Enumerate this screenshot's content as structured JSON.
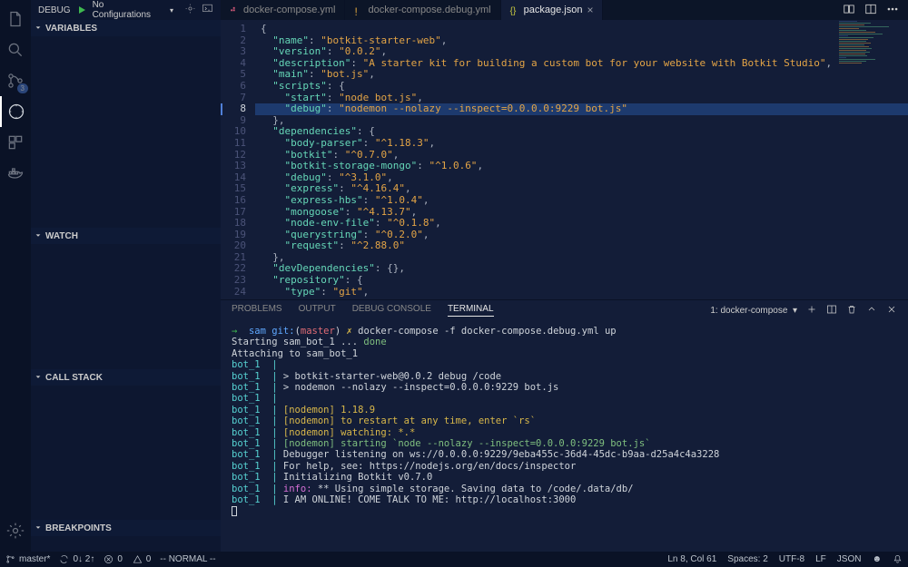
{
  "sidebar": {
    "debug_label": "DEBUG",
    "no_configurations": "No Configurations",
    "sections": [
      {
        "label": "VARIABLES"
      },
      {
        "label": "WATCH"
      },
      {
        "label": "CALL STACK"
      },
      {
        "label": "BREAKPOINTS"
      }
    ],
    "scm_badge": "3"
  },
  "tabs": [
    {
      "label": "docker-compose.yml",
      "icon": "docker",
      "dirty": false,
      "active": false
    },
    {
      "label": "docker-compose.debug.yml",
      "icon": "warn",
      "dirty": false,
      "active": false
    },
    {
      "label": "package.json",
      "icon": "json",
      "dirty": false,
      "active": true
    }
  ],
  "editor": {
    "lines": [
      {
        "n": 1,
        "tokens": [
          [
            "p",
            "{"
          ]
        ]
      },
      {
        "n": 2,
        "tokens": [
          [
            "p",
            "  "
          ],
          [
            "k",
            "\"name\""
          ],
          [
            "p",
            ": "
          ],
          [
            "s",
            "\"botkit-starter-web\""
          ],
          [
            "p",
            ","
          ]
        ]
      },
      {
        "n": 3,
        "tokens": [
          [
            "p",
            "  "
          ],
          [
            "k",
            "\"version\""
          ],
          [
            "p",
            ": "
          ],
          [
            "s",
            "\"0.0.2\""
          ],
          [
            "p",
            ","
          ]
        ]
      },
      {
        "n": 4,
        "tokens": [
          [
            "p",
            "  "
          ],
          [
            "k",
            "\"description\""
          ],
          [
            "p",
            ": "
          ],
          [
            "s",
            "\"A starter kit for building a custom bot for your website with Botkit Studio\""
          ],
          [
            "p",
            ","
          ]
        ]
      },
      {
        "n": 5,
        "tokens": [
          [
            "p",
            "  "
          ],
          [
            "k",
            "\"main\""
          ],
          [
            "p",
            ": "
          ],
          [
            "s",
            "\"bot.js\""
          ],
          [
            "p",
            ","
          ]
        ]
      },
      {
        "n": 6,
        "tokens": [
          [
            "p",
            "  "
          ],
          [
            "k",
            "\"scripts\""
          ],
          [
            "p",
            ": {"
          ]
        ]
      },
      {
        "n": 7,
        "tokens": [
          [
            "p",
            "    "
          ],
          [
            "k",
            "\"start\""
          ],
          [
            "p",
            ": "
          ],
          [
            "s",
            "\"node bot.js\""
          ],
          [
            "p",
            ","
          ]
        ]
      },
      {
        "n": 8,
        "hl": true,
        "tokens": [
          [
            "p",
            "    "
          ],
          [
            "k",
            "\"debug\""
          ],
          [
            "p",
            ": "
          ],
          [
            "s",
            "\"nodemon --nolazy --inspect=0.0.0.0:9229 bot.js\""
          ]
        ]
      },
      {
        "n": 9,
        "tokens": [
          [
            "p",
            "  },"
          ]
        ]
      },
      {
        "n": 10,
        "tokens": [
          [
            "p",
            "  "
          ],
          [
            "k",
            "\"dependencies\""
          ],
          [
            "p",
            ": {"
          ]
        ]
      },
      {
        "n": 11,
        "tokens": [
          [
            "p",
            "    "
          ],
          [
            "k",
            "\"body-parser\""
          ],
          [
            "p",
            ": "
          ],
          [
            "s",
            "\"^1.18.3\""
          ],
          [
            "p",
            ","
          ]
        ]
      },
      {
        "n": 12,
        "tokens": [
          [
            "p",
            "    "
          ],
          [
            "k",
            "\"botkit\""
          ],
          [
            "p",
            ": "
          ],
          [
            "s",
            "\"^0.7.0\""
          ],
          [
            "p",
            ","
          ]
        ]
      },
      {
        "n": 13,
        "tokens": [
          [
            "p",
            "    "
          ],
          [
            "k",
            "\"botkit-storage-mongo\""
          ],
          [
            "p",
            ": "
          ],
          [
            "s",
            "\"^1.0.6\""
          ],
          [
            "p",
            ","
          ]
        ]
      },
      {
        "n": 14,
        "tokens": [
          [
            "p",
            "    "
          ],
          [
            "k",
            "\"debug\""
          ],
          [
            "p",
            ": "
          ],
          [
            "s",
            "\"^3.1.0\""
          ],
          [
            "p",
            ","
          ]
        ]
      },
      {
        "n": 15,
        "tokens": [
          [
            "p",
            "    "
          ],
          [
            "k",
            "\"express\""
          ],
          [
            "p",
            ": "
          ],
          [
            "s",
            "\"^4.16.4\""
          ],
          [
            "p",
            ","
          ]
        ]
      },
      {
        "n": 16,
        "tokens": [
          [
            "p",
            "    "
          ],
          [
            "k",
            "\"express-hbs\""
          ],
          [
            "p",
            ": "
          ],
          [
            "s",
            "\"^1.0.4\""
          ],
          [
            "p",
            ","
          ]
        ]
      },
      {
        "n": 17,
        "tokens": [
          [
            "p",
            "    "
          ],
          [
            "k",
            "\"mongoose\""
          ],
          [
            "p",
            ": "
          ],
          [
            "s",
            "\"^4.13.7\""
          ],
          [
            "p",
            ","
          ]
        ]
      },
      {
        "n": 18,
        "tokens": [
          [
            "p",
            "    "
          ],
          [
            "k",
            "\"node-env-file\""
          ],
          [
            "p",
            ": "
          ],
          [
            "s",
            "\"^0.1.8\""
          ],
          [
            "p",
            ","
          ]
        ]
      },
      {
        "n": 19,
        "tokens": [
          [
            "p",
            "    "
          ],
          [
            "k",
            "\"querystring\""
          ],
          [
            "p",
            ": "
          ],
          [
            "s",
            "\"^0.2.0\""
          ],
          [
            "p",
            ","
          ]
        ]
      },
      {
        "n": 20,
        "tokens": [
          [
            "p",
            "    "
          ],
          [
            "k",
            "\"request\""
          ],
          [
            "p",
            ": "
          ],
          [
            "s",
            "\"^2.88.0\""
          ]
        ]
      },
      {
        "n": 21,
        "tokens": [
          [
            "p",
            "  },"
          ]
        ]
      },
      {
        "n": 22,
        "tokens": [
          [
            "p",
            "  "
          ],
          [
            "k",
            "\"devDependencies\""
          ],
          [
            "p",
            ": {},"
          ]
        ]
      },
      {
        "n": 23,
        "tokens": [
          [
            "p",
            "  "
          ],
          [
            "k",
            "\"repository\""
          ],
          [
            "p",
            ": {"
          ]
        ]
      },
      {
        "n": 24,
        "tokens": [
          [
            "p",
            "    "
          ],
          [
            "k",
            "\"type\""
          ],
          [
            "p",
            ": "
          ],
          [
            "s",
            "\"git\""
          ],
          [
            "p",
            ","
          ]
        ]
      }
    ]
  },
  "panel": {
    "tabs": [
      {
        "label": "PROBLEMS",
        "active": false
      },
      {
        "label": "OUTPUT",
        "active": false
      },
      {
        "label": "DEBUG CONSOLE",
        "active": false
      },
      {
        "label": "TERMINAL",
        "active": true
      }
    ],
    "terminal_selector": "1: docker-compose",
    "terminal_lines": [
      [
        [
          "arrow",
          "→  "
        ],
        [
          "blue",
          "sam"
        ],
        [
          "p",
          " "
        ],
        [
          "blue",
          "git:"
        ],
        [
          "p",
          "("
        ],
        [
          "red",
          "master"
        ],
        [
          "p",
          ") "
        ],
        [
          "yel",
          "✗"
        ],
        [
          "p",
          " docker-compose -f docker-compose.debug.yml up"
        ]
      ],
      [
        [
          "p",
          "Starting sam_bot_1 ... "
        ],
        [
          "grn",
          "done"
        ]
      ],
      [
        [
          "p",
          "Attaching to sam_bot_1"
        ]
      ],
      [
        [
          "cyn",
          "bot_1  |"
        ]
      ],
      [
        [
          "cyn",
          "bot_1  | "
        ],
        [
          "p",
          "> botkit-starter-web@0.0.2 debug /code"
        ]
      ],
      [
        [
          "cyn",
          "bot_1  | "
        ],
        [
          "p",
          "> nodemon --nolazy --inspect=0.0.0.0:9229 bot.js"
        ]
      ],
      [
        [
          "cyn",
          "bot_1  |"
        ]
      ],
      [
        [
          "cyn",
          "bot_1  | "
        ],
        [
          "yel",
          "[nodemon] 1.18.9"
        ]
      ],
      [
        [
          "cyn",
          "bot_1  | "
        ],
        [
          "yel",
          "[nodemon] to restart at any time, enter `rs`"
        ]
      ],
      [
        [
          "cyn",
          "bot_1  | "
        ],
        [
          "yel",
          "[nodemon] watching: *.*"
        ]
      ],
      [
        [
          "cyn",
          "bot_1  | "
        ],
        [
          "grn",
          "[nodemon] starting `node --nolazy --inspect=0.0.0.0:9229 bot.js`"
        ]
      ],
      [
        [
          "cyn",
          "bot_1  | "
        ],
        [
          "p",
          "Debugger listening on ws://0.0.0.0:9229/9eba455c-36d4-45dc-b9aa-d25a4c4a3228"
        ]
      ],
      [
        [
          "cyn",
          "bot_1  | "
        ],
        [
          "p",
          "For help, see: https://nodejs.org/en/docs/inspector"
        ]
      ],
      [
        [
          "cyn",
          "bot_1  | "
        ],
        [
          "p",
          "Initializing Botkit v0.7.0"
        ]
      ],
      [
        [
          "cyn",
          "bot_1  | "
        ],
        [
          "mag",
          "info:"
        ],
        [
          "p",
          " ** Using simple storage. Saving data to /code/.data/db/"
        ]
      ],
      [
        [
          "cyn",
          "bot_1  | "
        ],
        [
          "p",
          "I AM ONLINE! COME TALK TO ME: http://localhost:3000"
        ]
      ]
    ]
  },
  "status": {
    "branch": "master*",
    "sync": "0↓ 2↑",
    "errors": "0",
    "warnings": "0",
    "vim_mode": "-- NORMAL --",
    "position": "Ln 8, Col 61",
    "spaces": "Spaces: 2",
    "encoding": "UTF-8",
    "eol": "LF",
    "language": "JSON",
    "feedback": "☻"
  }
}
